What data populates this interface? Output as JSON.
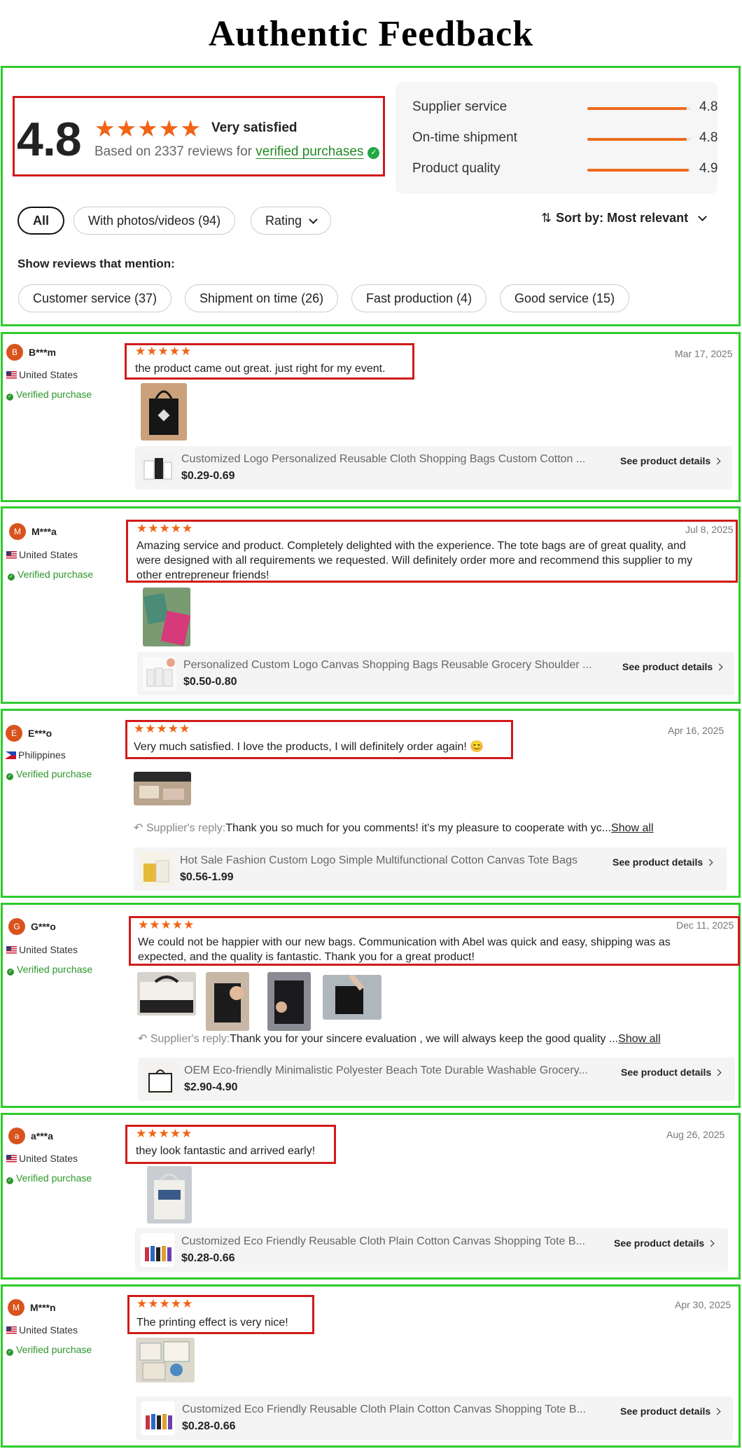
{
  "page_title": "Authentic Feedback",
  "summary": {
    "score": "4.8",
    "stars": "★★★★★",
    "label": "Very satisfied",
    "based_on": "Based on 2337 reviews for",
    "verified_link": "verified purchases",
    "metrics": [
      {
        "name": "Supplier service",
        "value": "4.8",
        "level": 0.96
      },
      {
        "name": "On-time shipment",
        "value": "4.8",
        "level": 0.96
      },
      {
        "name": "Product quality",
        "value": "4.9",
        "level": 0.98
      }
    ]
  },
  "filters": {
    "all": "All",
    "with_media": "With photos/videos (94)",
    "rating": "Rating",
    "sort": "Sort by: Most relevant"
  },
  "mention": {
    "label": "Show reviews that mention:",
    "tags": [
      "Customer service (37)",
      "Shipment on time (26)",
      "Fast production (4)",
      "Good service (15)"
    ]
  },
  "reviews": [
    {
      "initial": "B",
      "name": "B***m",
      "country": "United States",
      "verified": "Verified purchase",
      "stars": "★★★★★",
      "date": "Mar 17, 2025",
      "text": "the product came out great. just right for my event.",
      "product": {
        "name": "Customized Logo Personalized Reusable Cloth Shopping Bags Custom Cotton ...",
        "price": "$0.29-0.69",
        "link": "See product details"
      }
    },
    {
      "initial": "M",
      "name": "M***a",
      "country": "United States",
      "verified": "Verified purchase",
      "stars": "★★★★★",
      "date": "Jul 8, 2025",
      "text_lines": [
        "Amazing service and product. Completely delighted with the experience. The tote bags are of great quality, and",
        "were designed with all requirements we requested. Will definitely order more and recommend this supplier to my",
        "other entrepreneur friends!"
      ],
      "product": {
        "name": "Personalized Custom Logo Canvas Shopping Bags Reusable Grocery Shoulder ...",
        "price": "$0.50-0.80",
        "link": "See product details"
      }
    },
    {
      "initial": "E",
      "name": "E***o",
      "country": "Philippines",
      "verified": "Verified purchase",
      "stars": "★★★★★",
      "date": "Apr 16, 2025",
      "text": "Very much satisfied. I love the products, I will definitely order again! 😊",
      "reply_label": "Supplier's reply:",
      "reply": "Thank you so much for you comments! it's my pleasure to cooperate with yc...",
      "show_all": "Show all",
      "product": {
        "name": "Hot Sale Fashion Custom Logo Simple Multifunctional Cotton Canvas Tote Bags",
        "price": "$0.56-1.99",
        "link": "See product details"
      }
    },
    {
      "initial": "G",
      "name": "G***o",
      "country": "United States",
      "verified": "Verified purchase",
      "stars": "★★★★★",
      "date": "Dec 11, 2025",
      "text_lines": [
        "We could not be happier with our new bags. Communication with Abel was quick and easy, shipping was as",
        "expected, and the quality is fantastic. Thank you for a great product!"
      ],
      "reply_label": "Supplier's reply:",
      "reply": "Thank you for your sincere evaluation , we will always keep the good quality ...",
      "show_all": "Show all",
      "product": {
        "name": "OEM Eco-friendly Minimalistic Polyester Beach Tote Durable Washable Grocery...",
        "price": "$2.90-4.90",
        "link": "See product details"
      }
    },
    {
      "initial": "a",
      "name": "a***a",
      "country": "United States",
      "verified": "Verified purchase",
      "stars": "★★★★★",
      "date": "Aug 26, 2025",
      "text": "they look fantastic and arrived early!",
      "product": {
        "name": "Customized Eco Friendly Reusable Cloth Plain Cotton Canvas Shopping Tote B...",
        "price": "$0.28-0.66",
        "link": "See product details"
      }
    },
    {
      "initial": "M",
      "name": "M***n",
      "country": "United States",
      "verified": "Verified purchase",
      "stars": "★★★★★",
      "date": "Apr 30, 2025",
      "text": "The printing effect is very nice!",
      "product": {
        "name": "Customized Eco Friendly Reusable Cloth Plain Cotton Canvas Shopping Tote B...",
        "price": "$0.28-0.66",
        "link": "See product details"
      }
    }
  ]
}
